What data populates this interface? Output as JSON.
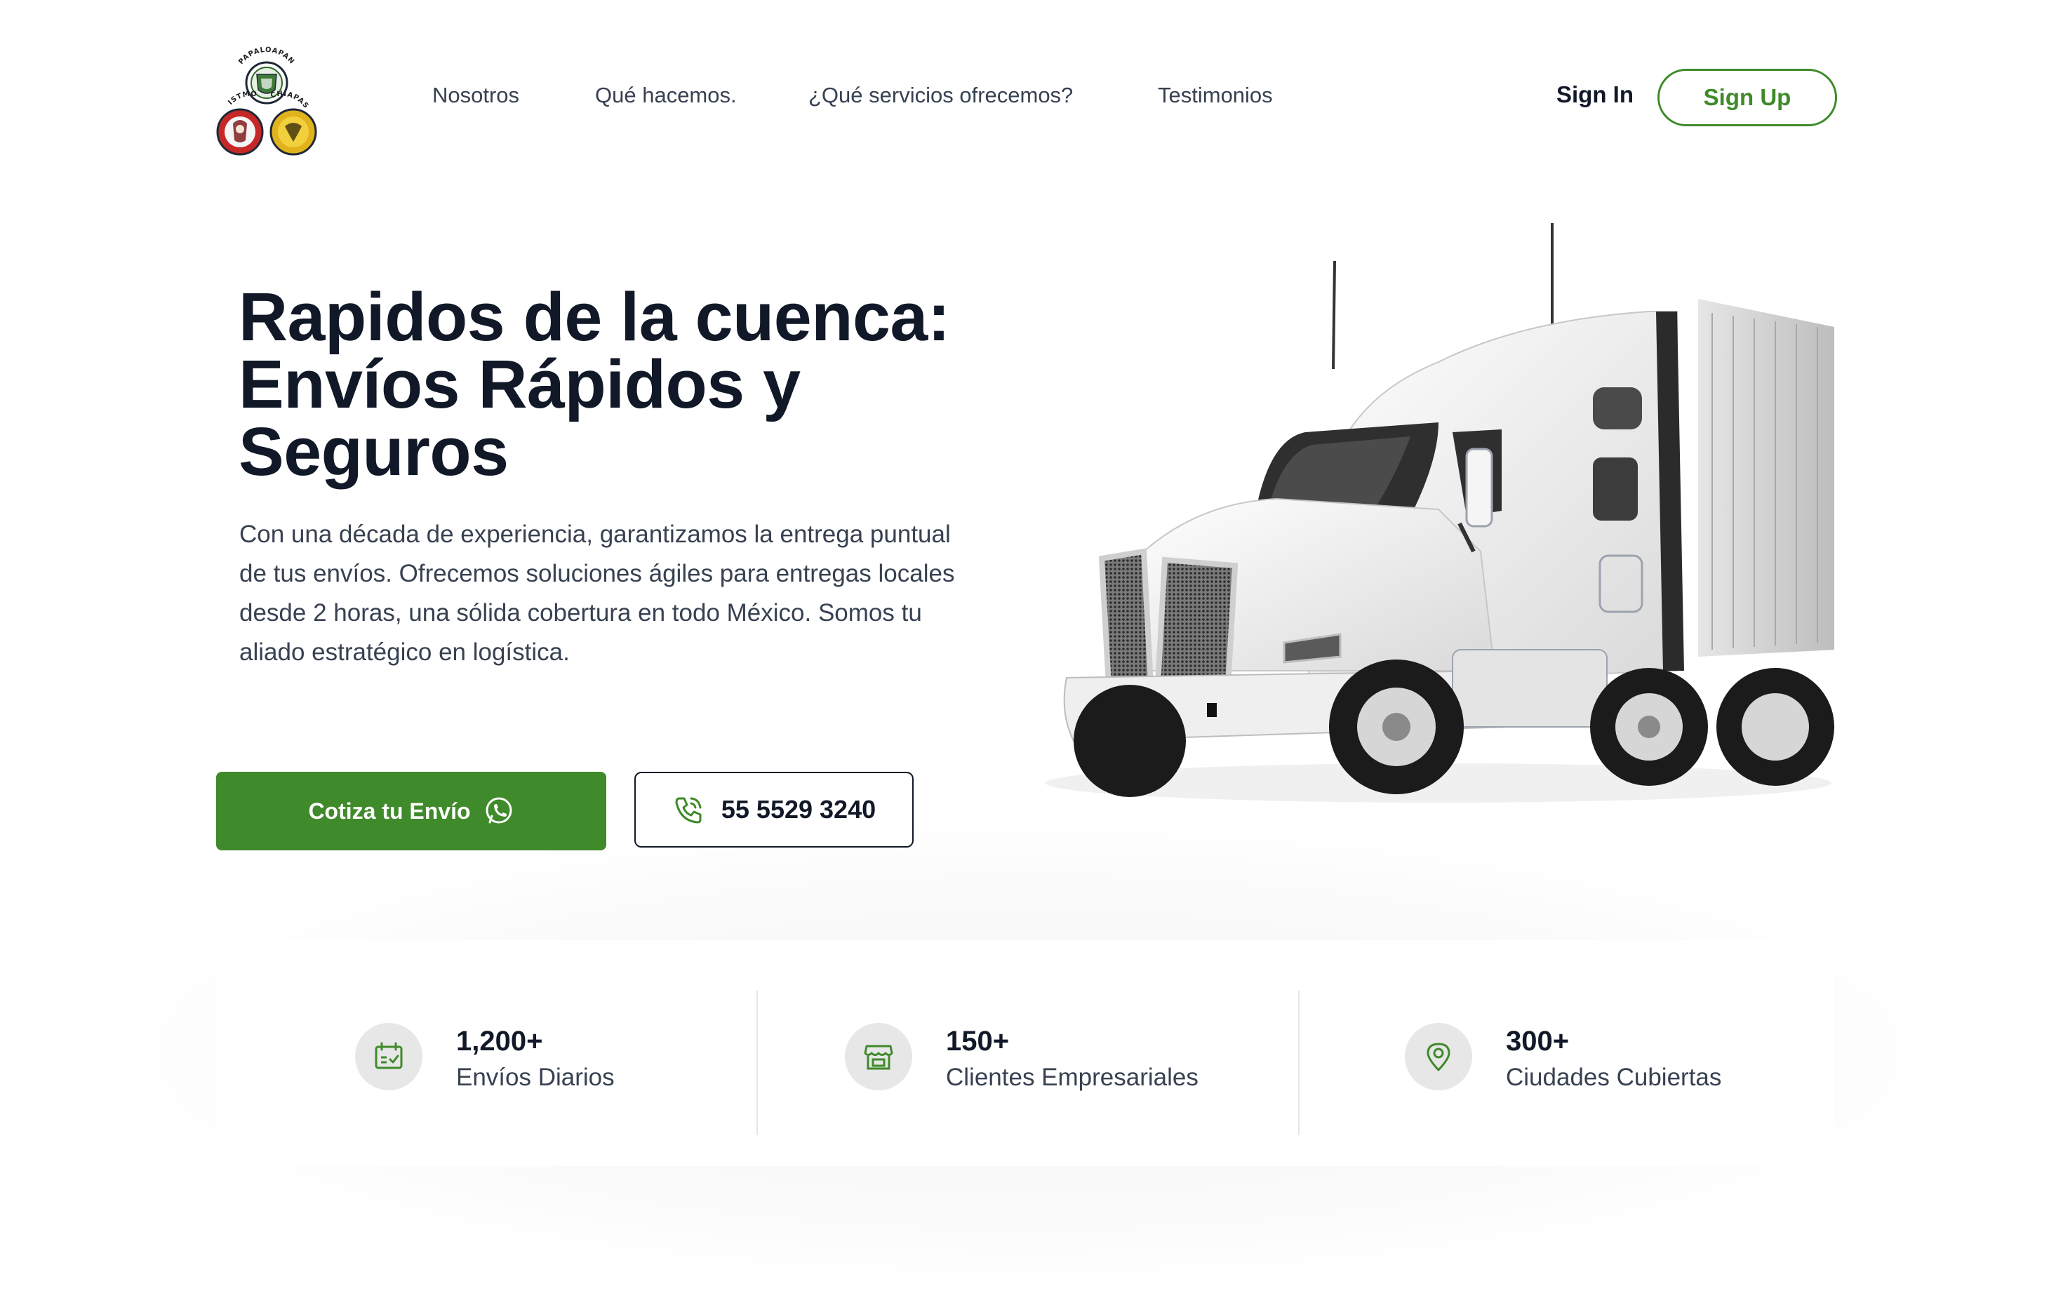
{
  "brand": {
    "top_text": "PAPALOAPAN",
    "left_text": "ISTMO",
    "right_text": "CHIAPAS"
  },
  "nav": {
    "items": [
      {
        "label": "Nosotros"
      },
      {
        "label": "Qué hacemos."
      },
      {
        "label": "¿Qué servicios ofrecemos?"
      },
      {
        "label": "Testimonios"
      }
    ],
    "sign_in": "Sign In",
    "sign_up": "Sign Up"
  },
  "hero": {
    "title": "Rapidos de la cuenca: Envíos Rápidos y Seguros",
    "description": "Con una década de experiencia, garantizamos la entrega puntual de tus envíos. Ofrecemos soluciones ágiles para entregas locales desde 2 horas, una sólida cobertura en todo México. Somos tu aliado estratégico en logística.",
    "quote_button": "Cotiza tu Envío",
    "phone_button": "55 5529 3240"
  },
  "stats": [
    {
      "value": "1,200+",
      "label": "Envíos Diarios",
      "icon": "calendar-check-icon"
    },
    {
      "value": "150+",
      "label": "Clientes Empresariales",
      "icon": "store-icon"
    },
    {
      "value": "300+",
      "label": "Ciudades Cubiertas",
      "icon": "map-pin-icon"
    }
  ],
  "colors": {
    "accent": "#3f8a2a",
    "text_dark": "#111827",
    "text_body": "#374151",
    "icon_bg": "#e7e7e7"
  }
}
